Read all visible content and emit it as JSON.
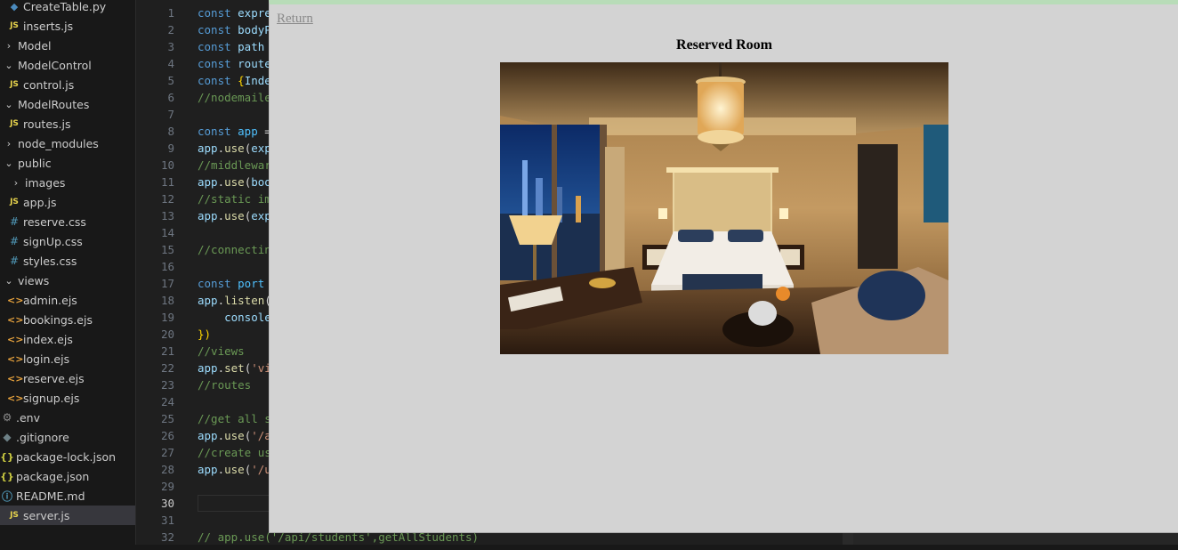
{
  "sidebar": {
    "items": [
      {
        "label": "CreateTable.py",
        "icon": "python-file-icon",
        "kind": "py"
      },
      {
        "label": "inserts.js",
        "icon": "js-file-icon",
        "kind": "js"
      },
      {
        "label": "Model",
        "icon": "chevron-right-icon",
        "kind": "folder-closed"
      },
      {
        "label": "ModelControl",
        "icon": "chevron-down-icon",
        "kind": "folder-open"
      },
      {
        "label": "control.js",
        "icon": "js-file-icon",
        "kind": "js"
      },
      {
        "label": "ModelRoutes",
        "icon": "chevron-down-icon",
        "kind": "folder-open"
      },
      {
        "label": "routes.js",
        "icon": "js-file-icon",
        "kind": "js"
      },
      {
        "label": "node_modules",
        "icon": "chevron-right-icon",
        "kind": "folder-closed"
      },
      {
        "label": "public",
        "icon": "chevron-down-icon",
        "kind": "folder-open"
      },
      {
        "label": "images",
        "icon": "chevron-right-icon",
        "kind": "folder-closed"
      },
      {
        "label": "app.js",
        "icon": "js-file-icon",
        "kind": "js"
      },
      {
        "label": "reserve.css",
        "icon": "css-file-icon",
        "kind": "css"
      },
      {
        "label": "signUp.css",
        "icon": "css-file-icon",
        "kind": "css"
      },
      {
        "label": "styles.css",
        "icon": "css-file-icon",
        "kind": "css"
      },
      {
        "label": "views",
        "icon": "chevron-down-icon",
        "kind": "folder-open"
      },
      {
        "label": "admin.ejs",
        "icon": "ejs-file-icon",
        "kind": "ejs"
      },
      {
        "label": "bookings.ejs",
        "icon": "ejs-file-icon",
        "kind": "ejs"
      },
      {
        "label": "index.ejs",
        "icon": "ejs-file-icon",
        "kind": "ejs"
      },
      {
        "label": "login.ejs",
        "icon": "ejs-file-icon",
        "kind": "ejs"
      },
      {
        "label": "reserve.ejs",
        "icon": "ejs-file-icon",
        "kind": "ejs"
      },
      {
        "label": "signup.ejs",
        "icon": "ejs-file-icon",
        "kind": "ejs"
      },
      {
        "label": ".env",
        "icon": "gear-icon",
        "kind": "env"
      },
      {
        "label": ".gitignore",
        "icon": "git-icon",
        "kind": "git"
      },
      {
        "label": "package-lock.json",
        "icon": "json-file-icon",
        "kind": "json"
      },
      {
        "label": "package.json",
        "icon": "json-file-icon",
        "kind": "json"
      },
      {
        "label": "README.md",
        "icon": "info-icon",
        "kind": "info"
      },
      {
        "label": "server.js",
        "icon": "js-file-icon",
        "kind": "js",
        "active": true
      }
    ]
  },
  "editor": {
    "current_line": 30,
    "lines": [
      {
        "n": "1",
        "tokens": [
          [
            "kw",
            "const "
          ],
          [
            "txt",
            "expre"
          ]
        ]
      },
      {
        "n": "2",
        "tokens": [
          [
            "kw",
            "const "
          ],
          [
            "txt",
            "bodyP"
          ]
        ]
      },
      {
        "n": "3",
        "tokens": [
          [
            "kw",
            "const "
          ],
          [
            "txt",
            "path"
          ]
        ]
      },
      {
        "n": "4",
        "tokens": [
          [
            "kw",
            "const "
          ],
          [
            "txt",
            "route"
          ]
        ]
      },
      {
        "n": "5",
        "tokens": [
          [
            "kw",
            "const "
          ],
          [
            "br",
            "{"
          ],
          [
            "txt",
            "Inde"
          ]
        ]
      },
      {
        "n": "6",
        "tokens": [
          [
            "cm",
            "//nodemaile"
          ]
        ]
      },
      {
        "n": "7",
        "tokens": []
      },
      {
        "n": "8",
        "tokens": [
          [
            "kw",
            "const "
          ],
          [
            "id",
            "app "
          ],
          [
            "pl",
            "="
          ]
        ]
      },
      {
        "n": "9",
        "tokens": [
          [
            "txt",
            "app"
          ],
          [
            "pl",
            "."
          ],
          [
            "fn",
            "use"
          ],
          [
            "pl",
            "("
          ],
          [
            "txt",
            "exp"
          ]
        ]
      },
      {
        "n": "10",
        "tokens": [
          [
            "cm",
            "//middlewar"
          ]
        ]
      },
      {
        "n": "11",
        "tokens": [
          [
            "txt",
            "app"
          ],
          [
            "pl",
            "."
          ],
          [
            "fn",
            "use"
          ],
          [
            "pl",
            "("
          ],
          [
            "txt",
            "boo"
          ]
        ]
      },
      {
        "n": "12",
        "tokens": [
          [
            "cm",
            "//static im"
          ]
        ]
      },
      {
        "n": "13",
        "tokens": [
          [
            "txt",
            "app"
          ],
          [
            "pl",
            "."
          ],
          [
            "fn",
            "use"
          ],
          [
            "pl",
            "("
          ],
          [
            "txt",
            "exp"
          ]
        ]
      },
      {
        "n": "14",
        "tokens": []
      },
      {
        "n": "15",
        "tokens": [
          [
            "cm",
            "//connectin"
          ]
        ]
      },
      {
        "n": "16",
        "tokens": []
      },
      {
        "n": "17",
        "tokens": [
          [
            "kw",
            "const "
          ],
          [
            "id",
            "port"
          ]
        ]
      },
      {
        "n": "18",
        "tokens": [
          [
            "txt",
            "app"
          ],
          [
            "pl",
            "."
          ],
          [
            "fn",
            "listen"
          ],
          [
            "pl",
            "("
          ]
        ]
      },
      {
        "n": "19",
        "tokens": [
          [
            "pl",
            "    "
          ],
          [
            "txt",
            "console"
          ]
        ]
      },
      {
        "n": "20",
        "tokens": [
          [
            "br",
            "})"
          ]
        ]
      },
      {
        "n": "21",
        "tokens": [
          [
            "cm",
            "//views"
          ]
        ]
      },
      {
        "n": "22",
        "tokens": [
          [
            "txt",
            "app"
          ],
          [
            "pl",
            "."
          ],
          [
            "fn",
            "set"
          ],
          [
            "pl",
            "("
          ],
          [
            "str",
            "'vi"
          ]
        ]
      },
      {
        "n": "23",
        "tokens": [
          [
            "cm",
            "//routes"
          ]
        ]
      },
      {
        "n": "24",
        "tokens": []
      },
      {
        "n": "25",
        "tokens": [
          [
            "cm",
            "//get all s"
          ]
        ]
      },
      {
        "n": "26",
        "tokens": [
          [
            "txt",
            "app"
          ],
          [
            "pl",
            "."
          ],
          [
            "fn",
            "use"
          ],
          [
            "pl",
            "("
          ],
          [
            "str",
            "'/a"
          ]
        ]
      },
      {
        "n": "27",
        "tokens": [
          [
            "cm",
            "//create us"
          ]
        ]
      },
      {
        "n": "28",
        "tokens": [
          [
            "txt",
            "app"
          ],
          [
            "pl",
            "."
          ],
          [
            "fn",
            "use"
          ],
          [
            "pl",
            "("
          ],
          [
            "str",
            "'/u"
          ]
        ]
      },
      {
        "n": "29",
        "tokens": []
      },
      {
        "n": "30",
        "tokens": []
      },
      {
        "n": "31",
        "tokens": []
      },
      {
        "n": "32",
        "tokens": [
          [
            "cm",
            "// app.use('/api/students',getAllStudents)"
          ]
        ]
      }
    ]
  },
  "browser": {
    "return_label": "Return",
    "title": "Reserved Room",
    "image_alt": "hotel-room-photo"
  },
  "colors": {
    "browser_bg": "#d3d3d3",
    "link": "#8a8a8a",
    "editor_bg": "#1f1f1f",
    "sidebar_bg": "#181818"
  }
}
